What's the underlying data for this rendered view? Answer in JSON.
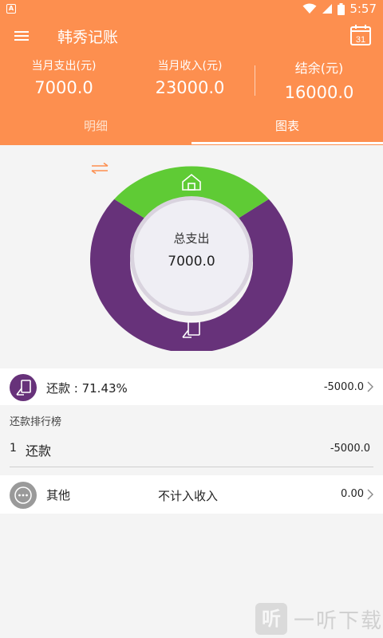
{
  "status_bar": {
    "time": "5:57",
    "badge": "A"
  },
  "app": {
    "title": "韩秀记账",
    "calendar_day": "31"
  },
  "summary": {
    "expense_label": "当月支出(元)",
    "expense_value": "7000.0",
    "income_label": "当月收入(元)",
    "income_value": "23000.0",
    "balance_label": "结余(元)",
    "balance_value": "16000.0"
  },
  "tabs": {
    "detail": "明细",
    "chart": "图表",
    "active": "chart"
  },
  "donut": {
    "center_title": "总支出",
    "center_value": "7000.0",
    "segments": [
      {
        "category": "还款",
        "share": 0.7143,
        "color": "#67327a",
        "icon": "repayment-icon"
      },
      {
        "category": "其他",
        "share": 0.2857,
        "color": "#5fcb35",
        "icon": "house-icon"
      }
    ]
  },
  "category_row": {
    "label": "还款 : 71.43%",
    "amount": "-5000.0",
    "icon": "repayment-icon",
    "color": "#67327a"
  },
  "ranking": {
    "title": "还款排行榜",
    "items": [
      {
        "rank": "1",
        "label": "还款",
        "amount": "-5000.0"
      }
    ]
  },
  "other_row": {
    "label": "其他",
    "middle": "不计入收入",
    "amount": "0.00",
    "icon": "more-icon",
    "color": "#9a9a9a"
  },
  "watermark": {
    "logo_char": "听",
    "text": "一听下载"
  },
  "colors": {
    "accent": "#fd8f4f",
    "repay": "#67327a",
    "green": "#5fcb35"
  }
}
